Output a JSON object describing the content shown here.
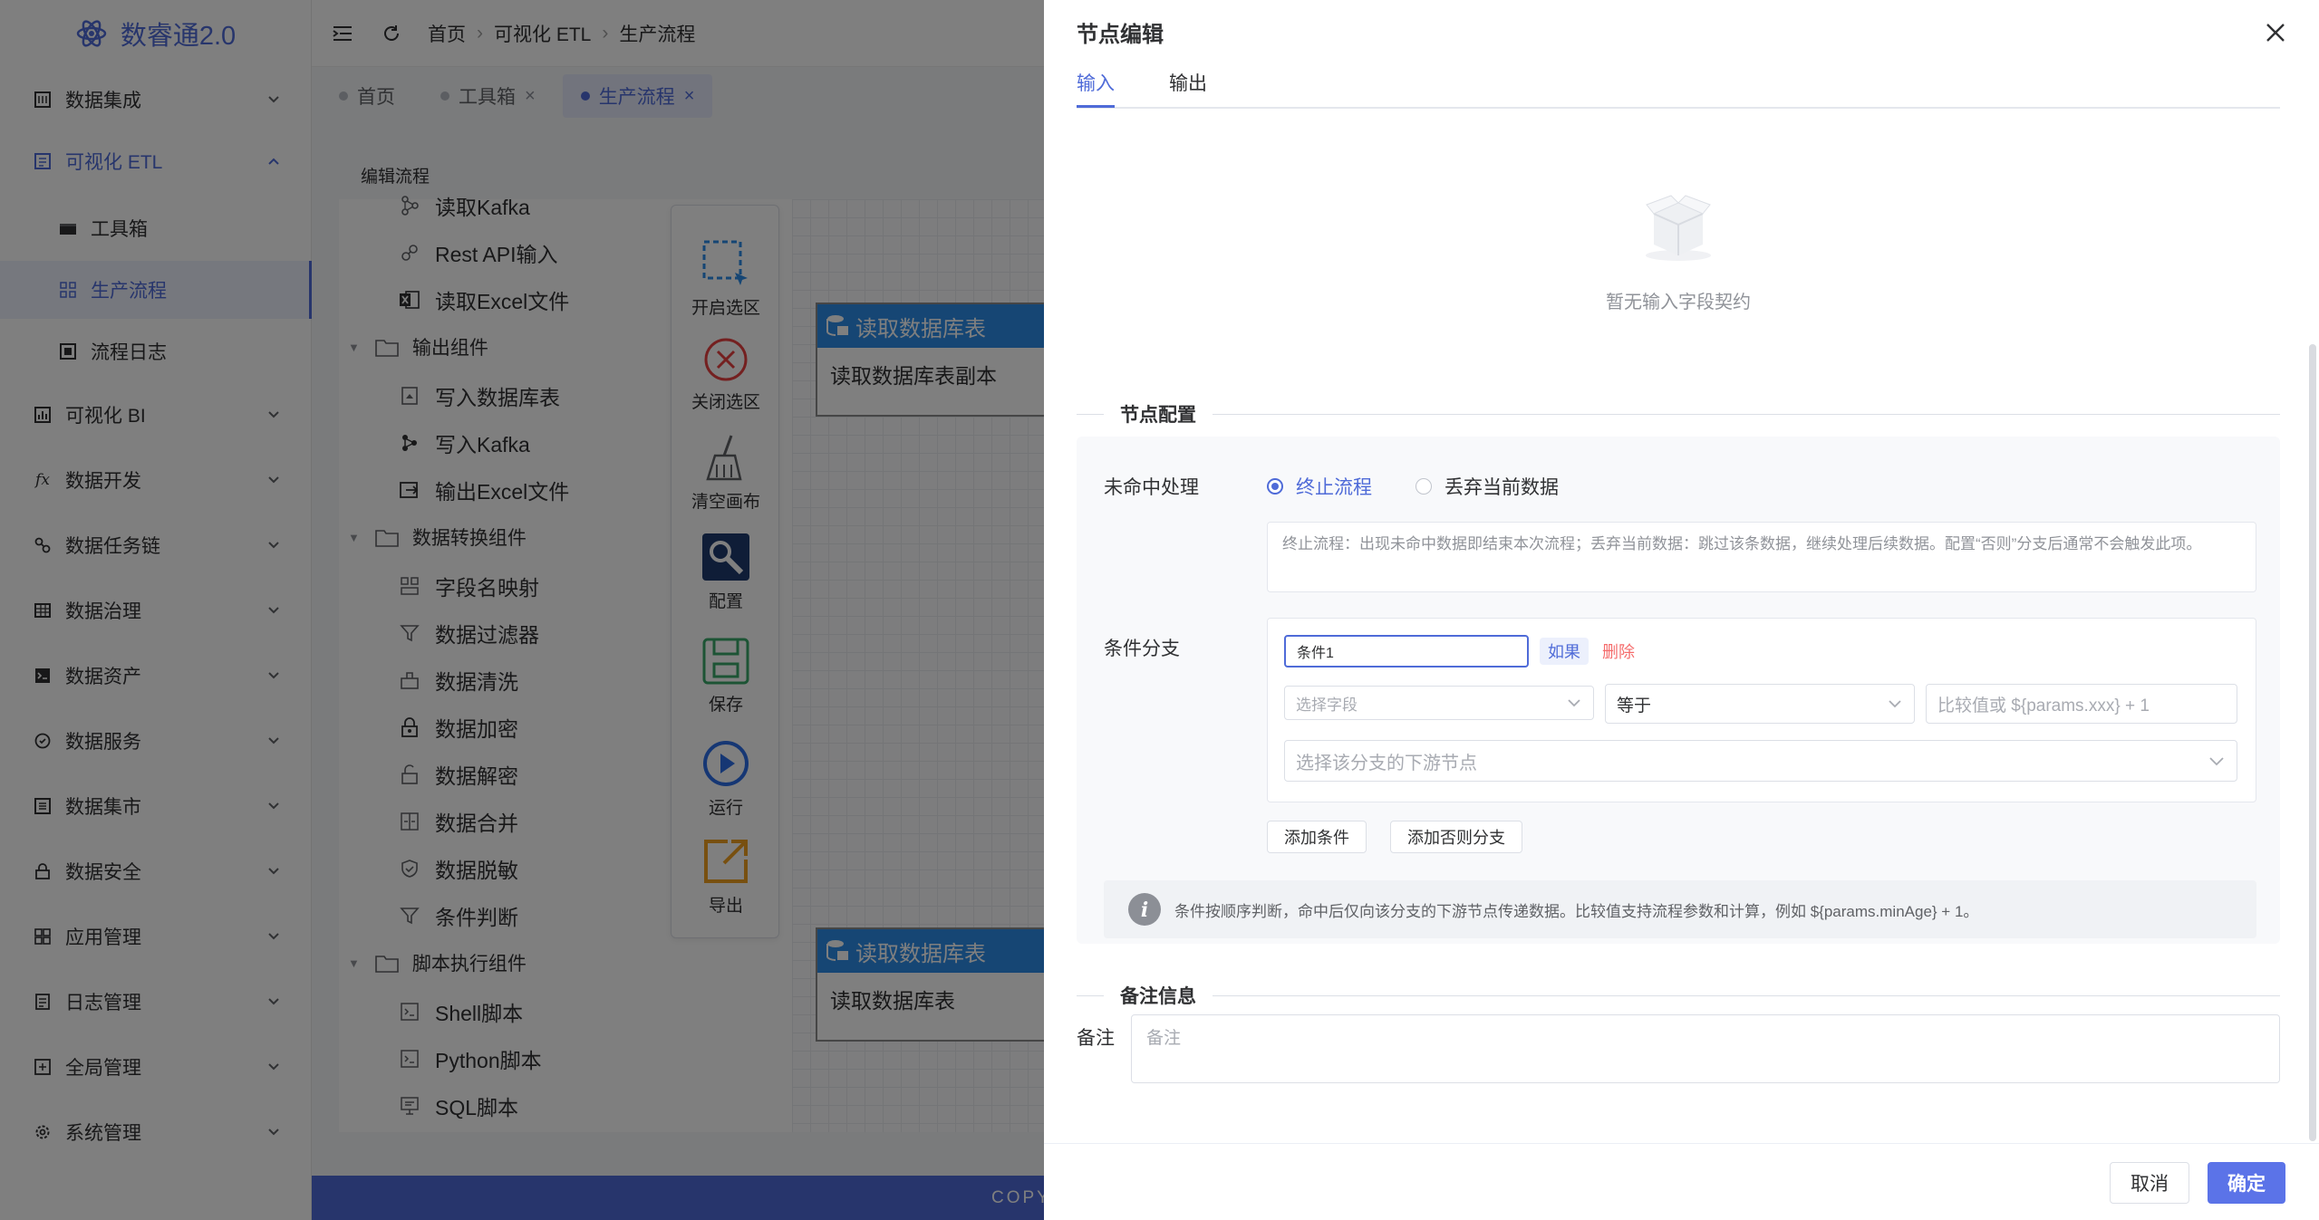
{
  "app": {
    "title": "数睿通2.0"
  },
  "sidebar": {
    "items": [
      {
        "label": "数据集成"
      },
      {
        "label": "可视化 ETL"
      },
      {
        "label": "工具箱"
      },
      {
        "label": "生产流程"
      },
      {
        "label": "流程日志"
      },
      {
        "label": "可视化 BI"
      },
      {
        "label": "数据开发"
      },
      {
        "label": "数据任务链"
      },
      {
        "label": "数据治理"
      },
      {
        "label": "数据资产"
      },
      {
        "label": "数据服务"
      },
      {
        "label": "数据集市"
      },
      {
        "label": "数据安全"
      },
      {
        "label": "应用管理"
      },
      {
        "label": "日志管理"
      },
      {
        "label": "全局管理"
      },
      {
        "label": "系统管理"
      }
    ]
  },
  "header": {
    "breadcrumb": [
      "首页",
      "可视化 ETL",
      "生产流程"
    ]
  },
  "tabs": [
    {
      "label": "首页"
    },
    {
      "label": "工具箱"
    },
    {
      "label": "生产流程"
    }
  ],
  "editor": {
    "title": "编辑流程",
    "tree": {
      "items": [
        "读取Kafka",
        "Rest API输入",
        "读取Excel文件",
        "输出组件",
        "写入数据库表",
        "写入Kafka",
        "输出Excel文件",
        "数据转换组件",
        "字段名映射",
        "数据过滤器",
        "数据清洗",
        "数据加密",
        "数据解密",
        "数据合并",
        "数据脱敏",
        "条件判断",
        "脚本执行组件",
        "Shell脚本",
        "Python脚本",
        "SQL脚本"
      ]
    },
    "toolbar": [
      "开启选区",
      "关闭选区",
      "清空画布",
      "配置",
      "保存",
      "运行",
      "导出"
    ],
    "nodes": [
      {
        "title": "读取数据库表",
        "body": "读取数据库表副本"
      },
      {
        "title": "读取数据库表",
        "body": "读取数据库表"
      }
    ],
    "footer": "COPY"
  },
  "drawer": {
    "title": "节点编辑",
    "tabs": [
      "输入",
      "输出"
    ],
    "empty_text": "暂无输入字段契约",
    "section_node_config": "节点配置",
    "miss_label": "未命中处理",
    "radio_stop": "终止流程",
    "radio_discard": "丢弃当前数据",
    "miss_hint": "终止流程：出现未命中数据即结束本次流程；丢弃当前数据：跳过该条数据，继续处理后续数据。配置“否则”分支后通常不会触发此项。",
    "branch_label": "条件分支",
    "condition_name": "条件1",
    "if_label": "如果",
    "delete_label": "删除",
    "field_placeholder": "选择字段",
    "operator_value": "等于",
    "compare_placeholder": "比较值或 ${params.xxx} + 1",
    "downstream_placeholder": "选择该分支的下游节点",
    "add_condition": "添加条件",
    "add_else": "添加否则分支",
    "tip": "条件按顺序判断，命中后仅向该分支的下游节点传递数据。比较值支持流程参数和计算，例如 ${params.minAge} + 1。",
    "section_remark": "备注信息",
    "remark_label": "备注",
    "remark_placeholder": "备注",
    "cancel": "取消",
    "ok": "确定"
  },
  "colors": {
    "primary": "#4f6bd8",
    "node_header": "#2c8de8",
    "danger": "#f56c6c"
  }
}
